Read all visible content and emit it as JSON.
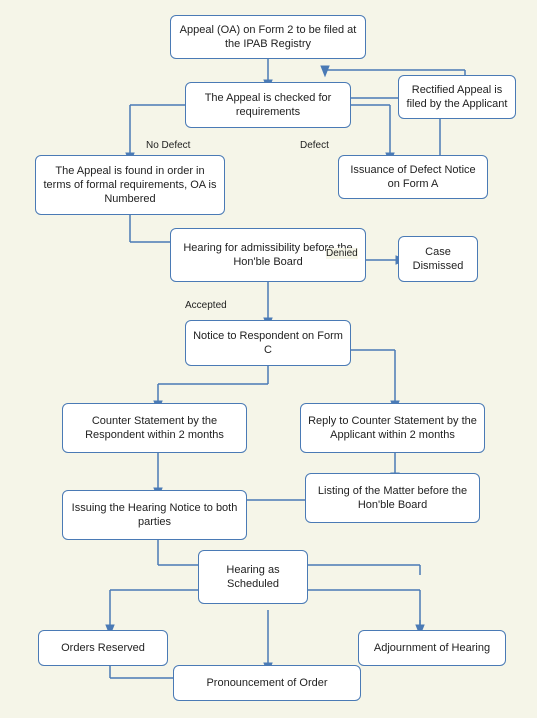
{
  "nodes": {
    "appeal_filed": {
      "label": "Appeal (OA) on Form 2 to be filed at\nthe IPAB Registry"
    },
    "appeal_checked": {
      "label": "The Appeal is checked for\nrequirements"
    },
    "rectified": {
      "label": "Rectified Appeal is\nfiled by the Applicant"
    },
    "formal_order": {
      "label": "The Appeal is found in order in\nterms of formal requirements,\nOA is Numbered"
    },
    "defect_notice": {
      "label": "Issuance of Defect Notice on\nForm A"
    },
    "admissibility": {
      "label": "Hearing for admissibility\nbefore the Hon'ble Board"
    },
    "case_dismissed": {
      "label": "Case\nDismissed"
    },
    "notice_respondent": {
      "label": "Notice to Respondent\non Form C"
    },
    "counter_statement": {
      "label": "Counter Statement by the\nRespondent within 2 months"
    },
    "reply_counter": {
      "label": "Reply to Counter Statement by\nthe Applicant within 2 months"
    },
    "listing_matter": {
      "label": "Listing of the Matter\nbefore the Hon'ble Board"
    },
    "issuing_notice": {
      "label": "Issuing the Hearing Notice to\nboth parties"
    },
    "hearing_scheduled": {
      "label": "Hearing as\nScheduled"
    },
    "orders_reserved": {
      "label": "Orders Reserved"
    },
    "adjournment": {
      "label": "Adjournment of Hearing"
    },
    "pronouncement": {
      "label": "Pronouncement of Order"
    }
  },
  "labels": {
    "no_defect": "No Defect",
    "defect": "Defect",
    "accepted": "Accepted",
    "denied": "Denied"
  }
}
